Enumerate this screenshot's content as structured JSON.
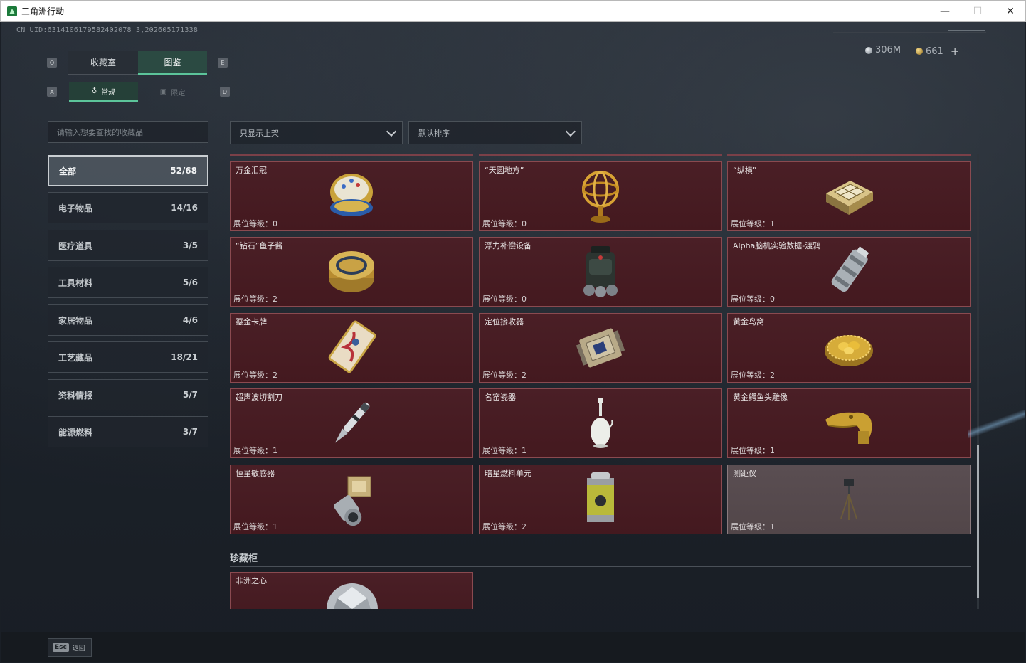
{
  "window": {
    "title": "三角洲行动",
    "minimize": "—",
    "maximize": "☐",
    "close": "✕"
  },
  "header": {
    "uid": "CN UID:6314106179582402078 3,202605171338",
    "currency": [
      {
        "icon": "silver-coin-icon",
        "value": "306M"
      },
      {
        "icon": "gold-coin-icon",
        "value": "661"
      }
    ],
    "plus_label": "+"
  },
  "tabs": {
    "left_key": "Q",
    "right_key": "E",
    "primary": [
      {
        "label": "收藏室",
        "active": false
      },
      {
        "label": "图鉴",
        "active": true
      }
    ],
    "secondary_left_key": "A",
    "secondary_right_key": "D",
    "secondary": [
      {
        "label": "常规",
        "icon": "normal-icon",
        "active": true
      },
      {
        "label": "限定",
        "icon": "limited-icon",
        "active": false
      }
    ]
  },
  "search": {
    "placeholder": "请输入想要查找的收藏品"
  },
  "categories": [
    {
      "label": "全部",
      "count": "52/68",
      "active": true
    },
    {
      "label": "电子物品",
      "count": "14/16"
    },
    {
      "label": "医疗道具",
      "count": "3/5"
    },
    {
      "label": "工具材料",
      "count": "5/6"
    },
    {
      "label": "家居物品",
      "count": "4/6"
    },
    {
      "label": "工艺藏品",
      "count": "18/21"
    },
    {
      "label": "资料情报",
      "count": "5/7"
    },
    {
      "label": "能源燃料",
      "count": "3/7"
    }
  ],
  "filters": {
    "show_filter": "只显示上架",
    "sort": "默认排序"
  },
  "items": [
    {
      "name": "万金泪冠",
      "level": "展位等级：0",
      "icon": "jeweled-egg-icon"
    },
    {
      "name": "“天圆地方”",
      "level": "展位等级：0",
      "icon": "armillary-sphere-icon"
    },
    {
      "name": "“纵横”",
      "level": "展位等级：1",
      "icon": "chess-box-icon"
    },
    {
      "name": "“钻石”鱼子酱",
      "level": "展位等级：2",
      "icon": "caviar-tin-icon"
    },
    {
      "name": "浮力补偿设备",
      "level": "展位等级：0",
      "icon": "buoyancy-device-icon"
    },
    {
      "name": "Alpha脑机实验数据-渡鸦",
      "level": "展位等级：0",
      "icon": "data-canister-icon"
    },
    {
      "name": "鎏金卡牌",
      "level": "展位等级：2",
      "icon": "gilded-card-icon"
    },
    {
      "name": "定位接收器",
      "level": "展位等级：2",
      "icon": "locator-receiver-icon"
    },
    {
      "name": "黄金鸟窝",
      "level": "展位等级：2",
      "icon": "golden-nest-icon"
    },
    {
      "name": "超声波切割刀",
      "level": "展位等级：1",
      "icon": "ultrasonic-knife-icon"
    },
    {
      "name": "名窑瓷器",
      "level": "展位等级：1",
      "icon": "porcelain-vase-icon"
    },
    {
      "name": "黄金鳄鱼头雕像",
      "level": "展位等级：1",
      "icon": "gold-crocodile-icon"
    },
    {
      "name": "恒星敏感器",
      "level": "展位等级：1",
      "icon": "star-sensor-icon"
    },
    {
      "name": "暗星燃料单元",
      "level": "展位等级：2",
      "icon": "fuel-cell-icon"
    },
    {
      "name": "测距仪",
      "level": "展位等级：1",
      "icon": "rangefinder-icon"
    }
  ],
  "section": {
    "title": "珍藏柜"
  },
  "treasure_items": [
    {
      "name": "非洲之心",
      "icon": "diamond-icon"
    }
  ],
  "footer": {
    "esc_key": "Esc",
    "esc_label": "返回"
  }
}
